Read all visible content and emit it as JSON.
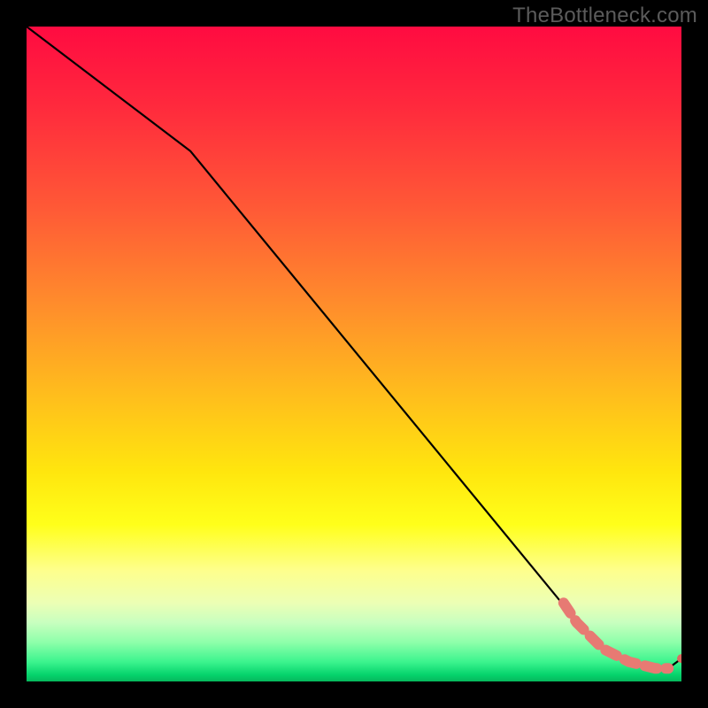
{
  "watermark": "TheBottleneck.com",
  "colors": {
    "page_bg": "#000000",
    "line": "#000000",
    "marker_stroke": "#e77a73",
    "marker_fill": "#e77a73",
    "end_dot": "#dd6a61",
    "gradient_stops": [
      "#ff0b41",
      "#ff293d",
      "#ff5a36",
      "#ff8b2c",
      "#ffb91e",
      "#ffe60e",
      "#ffff1a",
      "#feff8c",
      "#ecffb5",
      "#c8ffbf",
      "#8effaa",
      "#3cf48e",
      "#05d36c",
      "#06b85c"
    ]
  },
  "chart_data": {
    "type": "line",
    "title": "",
    "xlabel": "",
    "ylabel": "",
    "xlim": [
      0,
      100
    ],
    "ylim": [
      0,
      100
    ],
    "series": [
      {
        "name": "curve",
        "x": [
          0,
          25,
          85,
          88,
          90,
          92,
          94,
          96,
          98,
          100
        ],
        "values": [
          100,
          81,
          8,
          5,
          4,
          3,
          2.5,
          2,
          2,
          3.5
        ]
      }
    ],
    "highlight": {
      "name": "highlight-segment",
      "x": [
        82,
        84,
        86,
        88,
        90,
        92,
        94,
        96,
        98
      ],
      "values": [
        12,
        9,
        7,
        5,
        4,
        3,
        2.5,
        2,
        2
      ]
    },
    "end_point": {
      "x": 100,
      "y": 3.5
    }
  }
}
